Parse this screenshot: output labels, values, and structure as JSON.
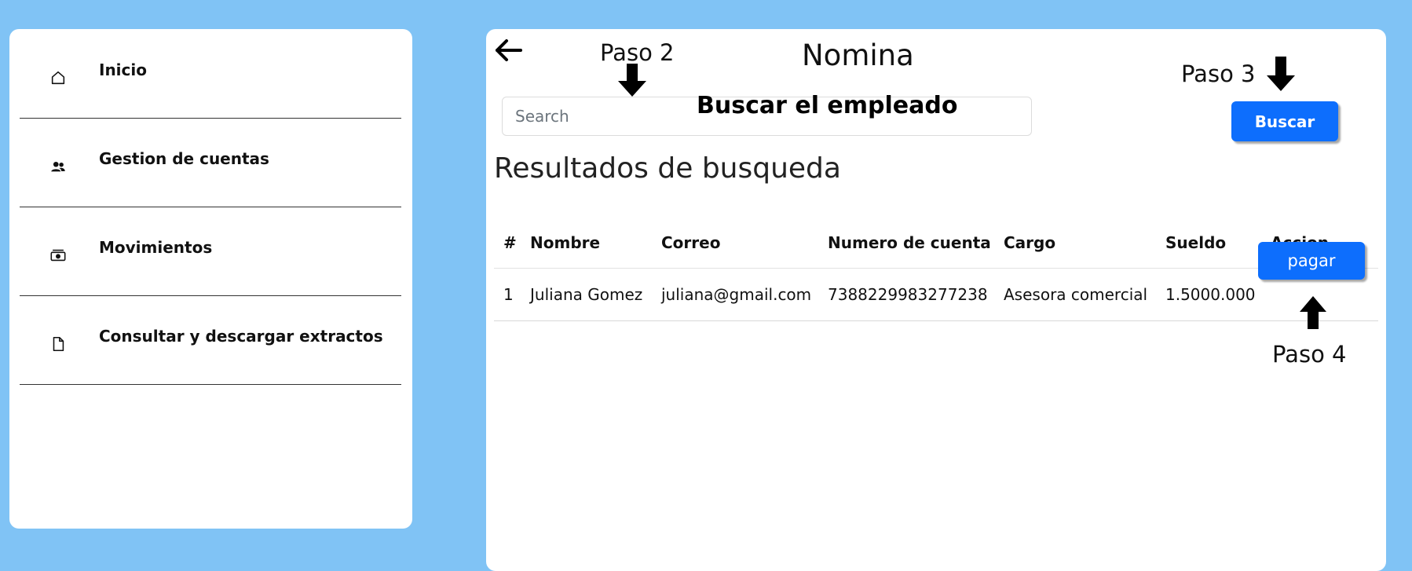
{
  "sidebar": {
    "items": [
      {
        "label": "Inicio",
        "icon": "home-icon"
      },
      {
        "label": "Gestion de cuentas",
        "icon": "users-icon"
      },
      {
        "label": "Movimientos",
        "icon": "cash-icon"
      },
      {
        "label": "Consultar y descargar extractos",
        "icon": "file-icon"
      }
    ]
  },
  "main": {
    "title": "Nomina",
    "back_icon": "arrow-left-icon",
    "steps": {
      "step2": "Paso 2",
      "step3": "Paso 3",
      "step4": "Paso 4"
    },
    "search": {
      "placeholder": "Search",
      "hint": "Buscar el empleado",
      "button_label": "Buscar"
    },
    "results_title": "Resultados de busqueda",
    "table": {
      "headers": [
        "#",
        "Nombre",
        "Correo",
        "Numero de cuenta",
        "Cargo",
        "Sueldo",
        "Accion"
      ],
      "rows": [
        {
          "num": "1",
          "nombre": "Juliana Gomez",
          "correo": "juliana@gmail.com",
          "cuenta": "7388229983277238",
          "cargo": "Asesora comercial",
          "sueldo": "1.5000.000",
          "accion": "pagar"
        }
      ]
    }
  },
  "colors": {
    "background": "#80c3f5",
    "primary": "#0d6efd",
    "panel": "#ffffff"
  }
}
